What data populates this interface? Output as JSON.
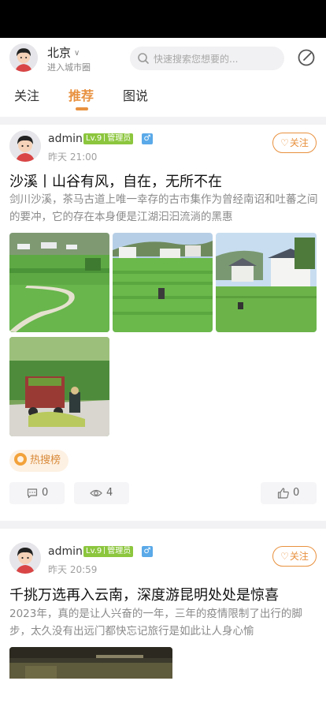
{
  "header": {
    "city": "北京",
    "city_sub": "进入城市圈",
    "search_placeholder": "快速搜索您想要的..."
  },
  "tabs": [
    {
      "label": "关注",
      "active": false
    },
    {
      "label": "推荐",
      "active": true
    },
    {
      "label": "图说",
      "active": false
    }
  ],
  "colors": {
    "accent": "#e8913f",
    "level_badge": "#8cc63e",
    "gender_badge": "#5aa9e8"
  },
  "posts": [
    {
      "username": "admin",
      "level": "Lv.9",
      "role": "管理员",
      "gender_icon": "male-icon",
      "gender_symbol": "♂",
      "time": "昨天 21:00",
      "follow_label": "关注",
      "title": "沙溪丨山谷有风，自在，无所不在",
      "excerpt": "剑川沙溪，茶马古道上唯一幸存的古市集作为曾经南诏和吐蕃之间的要冲，它的存在本身便是江湖汩汩流淌的黑惠",
      "tag": "热搜榜",
      "comments": "0",
      "views": "4",
      "likes": "0"
    },
    {
      "username": "admin",
      "level": "Lv.9",
      "role": "管理员",
      "gender_icon": "male-icon",
      "gender_symbol": "♂",
      "time": "昨天 20:59",
      "follow_label": "关注",
      "title": "千挑万选再入云南，深度游昆明处处是惊喜",
      "excerpt": "2023年，真的是让人兴奋的一年，三年的疫情限制了出行的脚步，太久没有出远门都快忘记旅行是如此让人身心愉"
    }
  ]
}
